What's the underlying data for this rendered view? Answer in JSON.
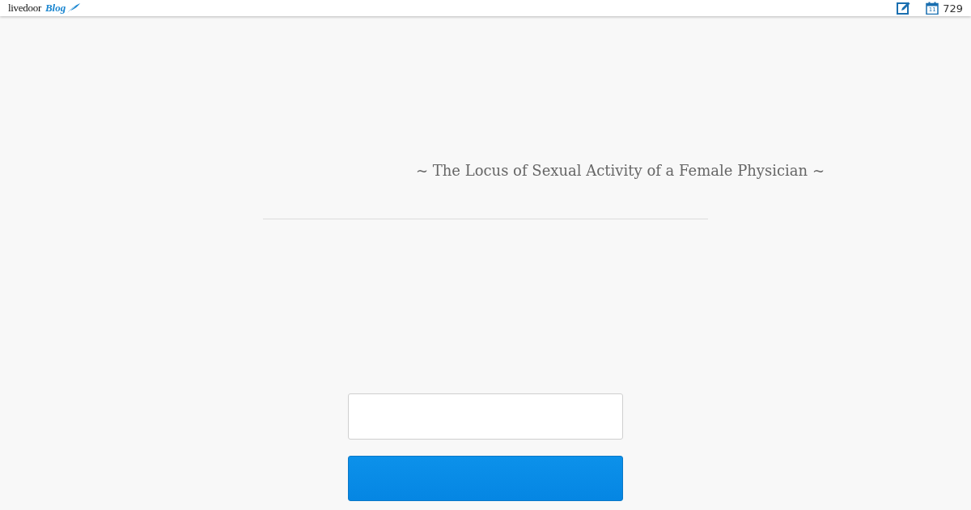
{
  "header": {
    "logo": {
      "brand": "livedoor",
      "product": "Blog"
    },
    "calendar_day": "11",
    "count": "729"
  },
  "blog_title": "~ The Locus of Sexual Activity of a Female Physician ~"
}
